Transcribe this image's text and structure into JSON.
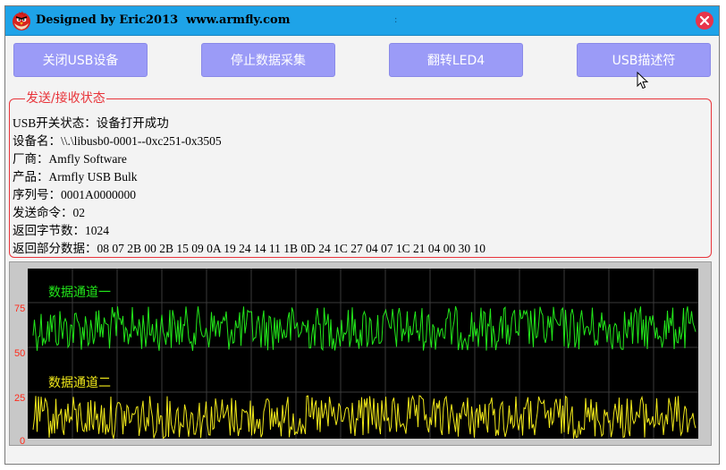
{
  "window": {
    "title": "Designed by Eric2013  www.armfly.com",
    "title_dot": ":"
  },
  "buttons": [
    {
      "label": "关闭USB设备"
    },
    {
      "label": "停止数据采集"
    },
    {
      "label": "翻转LED4"
    },
    {
      "label": "USB描述符"
    }
  ],
  "status_group": {
    "legend": "发送/接收状态",
    "lines": [
      "USB开关状态：设备打开成功",
      "设备名：\\\\.\\libusb0-0001--0xc251-0x3505",
      "厂商：Amfly Software",
      "产品：Armfly USB Bulk",
      "序列号：0001A0000000",
      "发送命令：02",
      "返回字节数：1024",
      "返回部分数据：08 07 2B 00 2B 15 09 0A 19 24 14 11 1B 0D 24 1C 27 04 07 1C 21 04 00 30 10"
    ]
  },
  "scope": {
    "y_ticks": [
      "75",
      "50",
      "25",
      "0"
    ],
    "channels": [
      {
        "name": "数据通道一",
        "color": "#22e81a"
      },
      {
        "name": "数据通道二",
        "color": "#f0e81a"
      }
    ],
    "grid_color": "#3a3a3a",
    "tick_color": "#ff2a1a"
  },
  "colors": {
    "titlebar": "#1ea3e8",
    "button": "#9b9bf7",
    "group_border": "#e8343a",
    "close": "#e8344a"
  }
}
